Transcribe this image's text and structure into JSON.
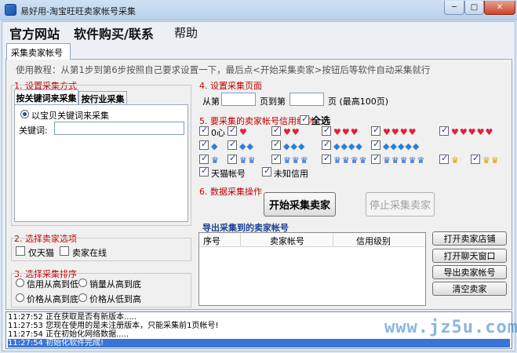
{
  "window": {
    "title": "易好用-淘宝旺旺卖家帐号采集",
    "min_symbol": "─",
    "max_symbol": "□",
    "close_symbol": "✕"
  },
  "menu": {
    "official_site": "官方网站",
    "buy_contact": "软件购买/联系",
    "help": "帮助"
  },
  "main_tab": "采集卖家帐号",
  "tutorial": "使用教程：从第1步到第6步按照自己要求设置一下，最后点<开始采集卖家>按钮后等软件自动采集就行",
  "step1": {
    "title": "1. 设置采集方式",
    "tabs": [
      "按关键词来采集",
      "按行业采集"
    ],
    "radio_label": "以宝贝关键词来采集",
    "keyword_label": "关键词:",
    "keyword_value": ""
  },
  "step2": {
    "title": "2. 选择卖家选项",
    "options": [
      "仅天猫",
      "卖家在线"
    ]
  },
  "step3": {
    "title": "3. 选择采集排序",
    "options": [
      "信用从高到低",
      "销量从高到底",
      "价格从高到底",
      "价格从低到高"
    ]
  },
  "step4": {
    "title": "4. 设置采集页面",
    "from_label": "从第",
    "to_label": "页到第",
    "suffix": "页 (最高100页)",
    "from_value": "",
    "to_value": ""
  },
  "step5": {
    "title": "5. 要采集的卖家帐号信用级别",
    "select_all": "全选",
    "zero_heart": "0心",
    "tmall_account": "天猫帐号",
    "unknown_credit": "未知信用",
    "levels": [
      {
        "icon": "heart",
        "count": 1
      },
      {
        "icon": "heart",
        "count": 2
      },
      {
        "icon": "heart",
        "count": 3
      },
      {
        "icon": "heart",
        "count": 4
      },
      {
        "icon": "heart",
        "count": 5
      },
      {
        "icon": "diamond",
        "count": 1
      },
      {
        "icon": "diamond",
        "count": 2
      },
      {
        "icon": "diamond",
        "count": 3
      },
      {
        "icon": "diamond",
        "count": 4
      },
      {
        "icon": "diamond",
        "count": 5
      },
      {
        "icon": "crown-blue",
        "count": 1
      },
      {
        "icon": "crown-blue",
        "count": 2
      },
      {
        "icon": "crown-blue",
        "count": 3
      },
      {
        "icon": "crown-blue",
        "count": 4
      },
      {
        "icon": "crown-blue",
        "count": 5
      },
      {
        "icon": "crown-gold",
        "count": 1
      },
      {
        "icon": "crown-gold",
        "count": 2
      }
    ]
  },
  "step6": {
    "title": "6. 数据采集操作",
    "start_button": "开始采集卖家",
    "stop_button": "停止采集卖家"
  },
  "export": {
    "title": "导出采集到的卖家帐号",
    "columns": [
      "序号",
      "卖家帐号",
      "信用级别"
    ],
    "rows": []
  },
  "side_buttons": [
    "打开卖家店铺",
    "打开聊天窗口",
    "导出卖家帐号",
    "清空卖家"
  ],
  "log": [
    {
      "time": "11:27:52",
      "text": "正在获取是否有新版本....."
    },
    {
      "time": "11:27:53",
      "text": "您现在使用的是未注册版本，只能采集前1页帐号!"
    },
    {
      "time": "11:27:54",
      "text": "正在初始化网络数据....."
    },
    {
      "time": "11:27:54",
      "text": "初始化软件完成!"
    }
  ],
  "watermark": "www.jz5u.com",
  "colors": {
    "section_title": "#c00000",
    "selection": "#3875d7",
    "heart": "#e0203a",
    "diamond": "#2a7fd4",
    "crown_blue": "#1f63c8",
    "crown_gold": "#d9a100"
  }
}
